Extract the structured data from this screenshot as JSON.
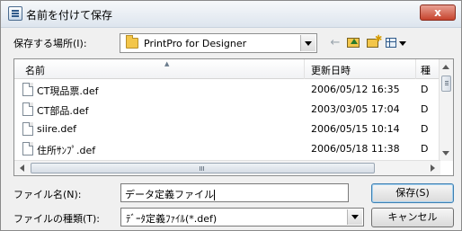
{
  "window": {
    "title": "名前を付けて保存",
    "close_label": "x"
  },
  "toolbar": {
    "save_in_label": "保存する場所(I):",
    "location": "PrintPro for Designer",
    "back_icon": "back-arrow-icon",
    "up_icon": "up-folder-icon",
    "new_folder_icon": "new-folder-icon",
    "views_icon": "views-menu-icon"
  },
  "file_list": {
    "columns": [
      {
        "label": "名前"
      },
      {
        "label": "更新日時"
      },
      {
        "label": "種"
      }
    ],
    "rows": [
      {
        "name": "CT現品票.def",
        "date": "2006/05/12 16:35",
        "type": "D"
      },
      {
        "name": "CT部品.def",
        "date": "2003/03/05 17:04",
        "type": "D"
      },
      {
        "name": "siire.def",
        "date": "2006/05/15 10:14",
        "type": "D"
      },
      {
        "name": "住所ｻﾝﾌﾟ.def",
        "date": "2006/05/18 11:38",
        "type": "D"
      }
    ]
  },
  "filename": {
    "label": "ファイル名(N):",
    "value": "データ定義ファイル"
  },
  "filetype": {
    "label": "ファイルの種類(T):",
    "value": "ﾃﾞｰﾀ定義ﾌｧｲﾙ(*.def)"
  },
  "buttons": {
    "save": "保存(S)",
    "cancel": "キャンセル"
  }
}
